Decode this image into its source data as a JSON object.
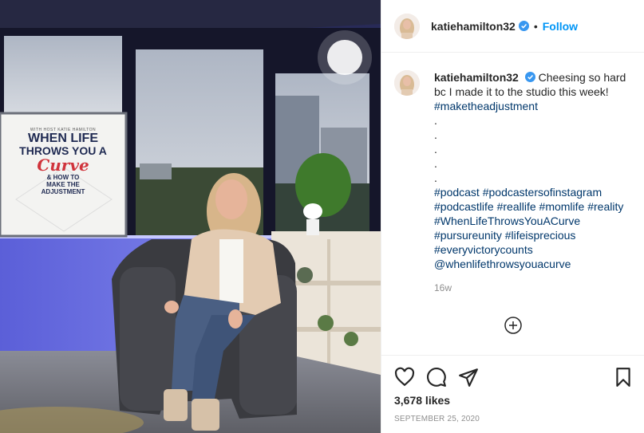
{
  "post": {
    "username": "katiehamilton32",
    "follow_label": "Follow",
    "separator": "•",
    "caption_lines": [
      "Cheesing so hard bc I made it to the studio this week!"
    ],
    "tags_line1": "#maketheadjustment",
    "dots": [
      ".",
      ".",
      ".",
      ".",
      "."
    ],
    "hashtags": [
      "#podcast",
      "#podcastersofinstagram",
      "#podcastlife",
      "#reallife",
      "#momlife",
      "#reality",
      "#WhenLifeThrowsYouACurve",
      "#pursureunity",
      "#lifeisprecious",
      "#everyvictorycounts",
      "@whenlifethrowsyouacurve"
    ],
    "time_ago": "16w",
    "likes": "3,678 likes",
    "date": "SEPTEMBER 25, 2020"
  },
  "photo": {
    "sign_small": "WITH HOST KATIE HAMILTON",
    "sign_line1": "WHEN LIFE",
    "sign_line2": "THROWS YOU A",
    "sign_curve": "Curve",
    "sign_line3": "& HOW TO",
    "sign_line4": "MAKE THE",
    "sign_line5": "ADJUSTMENT"
  },
  "icons": {
    "verified": "verified-badge-icon",
    "add_comment": "plus-circle-icon",
    "like": "heart-icon",
    "comment": "speech-bubble-icon",
    "share": "paper-plane-icon",
    "save": "bookmark-icon"
  },
  "colors": {
    "accent": "#0095f6",
    "tag": "#00376b",
    "muted": "#8e8e8e",
    "text": "#262626"
  }
}
